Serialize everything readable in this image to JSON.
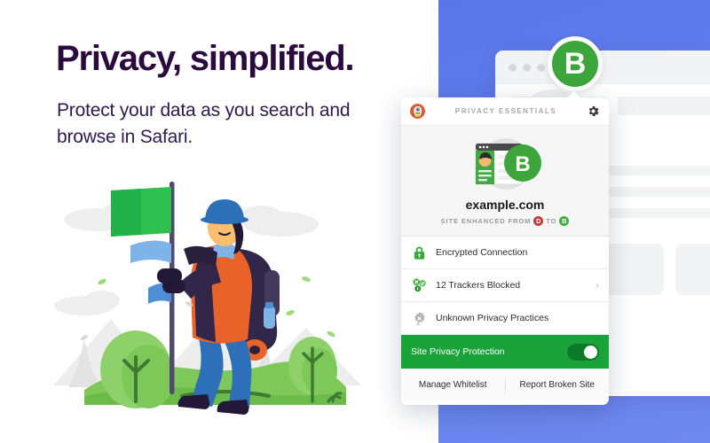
{
  "hero": {
    "headline": "Privacy, simplified.",
    "subtitle": "Protect your data as you search and browse in Safari.",
    "illustration_name": "hiker-with-green-flag-on-hill"
  },
  "colors": {
    "headline": "#2b0a3d",
    "subtitle": "#2e1a4d",
    "background_blue": "#6480ee",
    "grade_green": "#3ca63c",
    "protection_green": "#1aa33b",
    "grade_d_red": "#c43b3b"
  },
  "browser_mock": {
    "dots": 3,
    "grade_badge": "B"
  },
  "popup": {
    "header": {
      "logo_icon": "duckduckgo-logo-icon",
      "title": "PRIVACY ESSENTIALS",
      "settings_icon": "gear-icon"
    },
    "site": {
      "icon": "website-card-icon",
      "grade": "B",
      "name": "example.com",
      "enhanced_prefix": "SITE ENHANCED FROM",
      "grade_from": "D",
      "enhanced_middle": "TO",
      "grade_to": "B"
    },
    "rows": [
      {
        "icon": "lock-icon",
        "label": "Encrypted Connection",
        "chevron": ""
      },
      {
        "icon": "trackers-icon",
        "label": "12 Trackers Blocked",
        "chevron": "›"
      },
      {
        "icon": "privacy-practices-icon",
        "label": "Unknown Privacy Practices",
        "chevron": ""
      }
    ],
    "protection": {
      "label": "Site Privacy Protection",
      "enabled": true
    },
    "footer": {
      "manage_whitelist": "Manage Whitelist",
      "report_broken_site": "Report Broken Site"
    }
  }
}
